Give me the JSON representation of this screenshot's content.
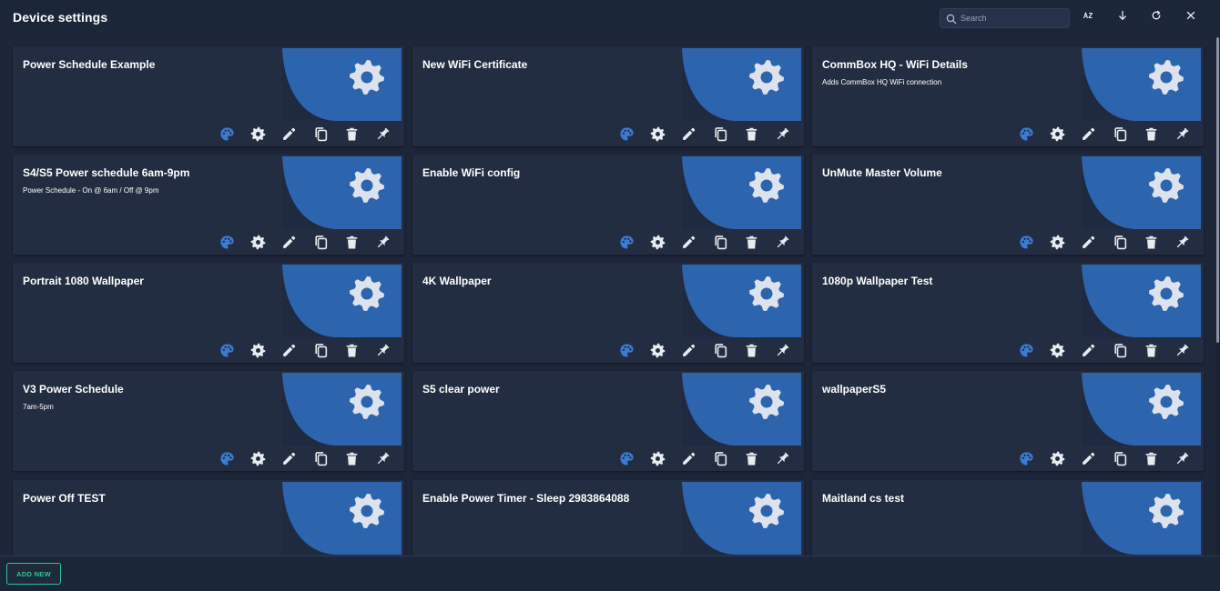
{
  "header": {
    "title": "Device settings",
    "search_placeholder": "Search",
    "buttons": [
      {
        "name": "sort-icon"
      },
      {
        "name": "download-icon"
      },
      {
        "name": "refresh-icon"
      },
      {
        "name": "close-icon"
      }
    ]
  },
  "colors": {
    "background": "#1c2639",
    "card": "#232d41",
    "thumbnail_blue": "#2d64ae",
    "gear": "#dce3ee",
    "palette_icon": "#3b7bd0",
    "action_icon": "#e8ebf0",
    "accent_green": "#2ec49a"
  },
  "card_actions": [
    "palette-icon",
    "gear-icon",
    "pencil-icon",
    "copy-icon",
    "trash-icon",
    "pin-icon"
  ],
  "cards": [
    {
      "title": "Power Schedule Example",
      "description": "",
      "palette_enabled": true
    },
    {
      "title": "New WiFi Certificate",
      "description": "",
      "palette_enabled": true
    },
    {
      "title": "CommBox HQ - WiFi Details",
      "description": "Adds CommBox HQ WiFi connection",
      "palette_enabled": true
    },
    {
      "title": "S4/S5 Power schedule 6am-9pm",
      "description": "Power Schedule - On @ 6am / Off @ 9pm",
      "palette_enabled": true
    },
    {
      "title": "Enable WiFi config",
      "description": "",
      "palette_enabled": true
    },
    {
      "title": "UnMute Master Volume",
      "description": "",
      "palette_enabled": true
    },
    {
      "title": "Portrait 1080 Wallpaper",
      "description": "",
      "palette_enabled": true
    },
    {
      "title": "4K Wallpaper",
      "description": "",
      "palette_enabled": true
    },
    {
      "title": "1080p Wallpaper Test",
      "description": "",
      "palette_enabled": true
    },
    {
      "title": "V3 Power Schedule",
      "description": "7am-5pm",
      "palette_enabled": true
    },
    {
      "title": "S5 clear power",
      "description": "",
      "palette_enabled": true
    },
    {
      "title": "wallpaperS5",
      "description": "",
      "palette_enabled": true
    },
    {
      "title": "Power Off TEST",
      "description": "",
      "palette_enabled": true
    },
    {
      "title": "Enable Power Timer - Sleep 2983864088",
      "description": "",
      "palette_enabled": true
    },
    {
      "title": "Maitland cs test",
      "description": "",
      "palette_enabled": true
    }
  ],
  "footer": {
    "add_button_label": "ADD NEW"
  }
}
